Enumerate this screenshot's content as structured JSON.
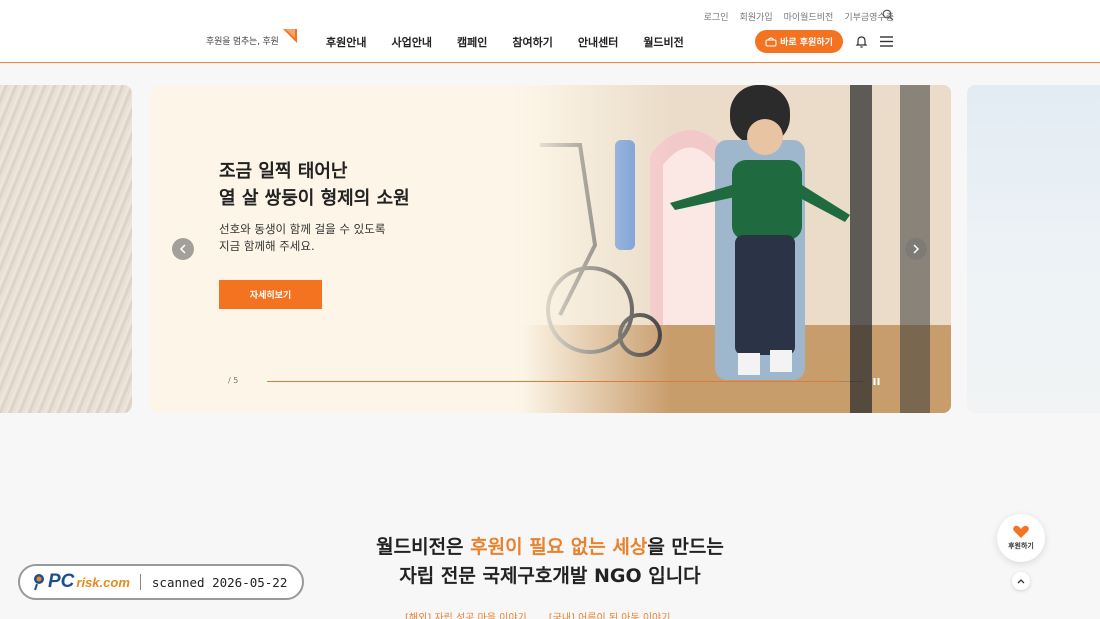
{
  "header": {
    "logo_text": "후원을 멈추는, 후원",
    "util_links": [
      "로그인",
      "회원가입",
      "마이월드비전",
      "기부금영수증"
    ],
    "nav": [
      "후원안내",
      "사업안내",
      "캠페인",
      "참여하기",
      "안내센터",
      "월드비전"
    ],
    "donate_button": "바로 후원하기",
    "accent_color": "#f37321"
  },
  "carousel": {
    "title": "조금 일찍 태어난\n열 살 쌍둥이 형제의 소원",
    "description": "선호와 동생이 함께 걸을 수 있도록\n지금 함께해 주세요.",
    "detail_button": "자세히보기",
    "pager": "/ 5",
    "progress": 0.96
  },
  "intro": {
    "line1_pre": "월드비전은 ",
    "line1_highlight": "후원이 필요 없는 세상",
    "line1_post": "을 만드는",
    "line2": "자립 전문 국제구호개발 NGO 입니다",
    "links": [
      "[해외] 자립 성공 마을 이야기",
      "[국내] 어른이 된 아동 이야기"
    ]
  },
  "floating": {
    "donate_label": "후원하기"
  },
  "watermark": {
    "brand_pc": "PC",
    "brand_risk": "risk.com",
    "text": "scanned 2026-05-22"
  }
}
